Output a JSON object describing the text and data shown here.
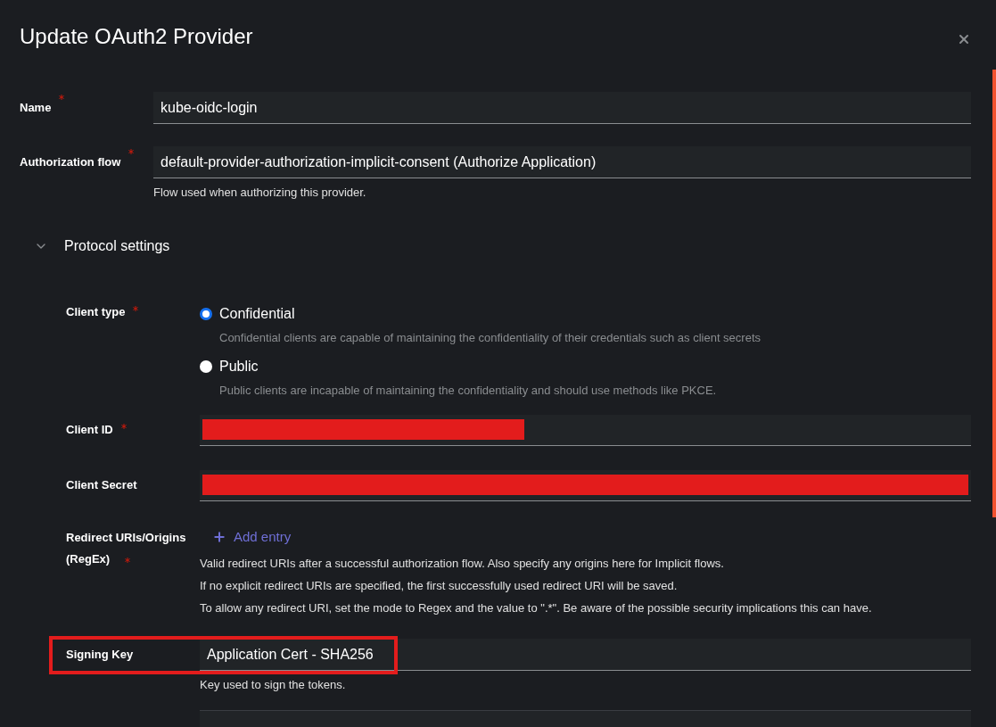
{
  "dialog": {
    "title": "Update OAuth2 Provider"
  },
  "fields": [
    {
      "label": "Name",
      "required": true,
      "value": "kube-oidc-login"
    },
    {
      "label": "Authorization flow",
      "required": true,
      "value": "default-provider-authorization-implicit-consent (Authorize Application)",
      "help": "Flow used when authorizing this provider."
    }
  ],
  "protocol_settings": {
    "label": "Protocol settings",
    "expanded": true,
    "client_type": {
      "label": "Client type",
      "required": true,
      "options": [
        {
          "label": "Confidential",
          "description": "Confidential clients are capable of maintaining the confidentiality of their credentials such as client secrets",
          "selected": true
        },
        {
          "label": "Public",
          "description": "Public clients are incapable of maintaining the confidentiality and should use methods like PKCE.",
          "selected": false
        }
      ]
    },
    "secrets": [
      {
        "label": "Client ID",
        "required": true,
        "kind": "partial"
      },
      {
        "label": "Client Secret",
        "kind": "full"
      }
    ],
    "redirect": {
      "label": "Redirect URIs/Origins (RegEx)",
      "required": true,
      "add_button": "Add entry",
      "help": [
        "Valid redirect URIs after a successful authorization flow. Also specify any origins here for Implicit flows.",
        "If no explicit redirect URIs are specified, the first successfully used redirect URI will be saved.",
        "To allow any redirect URI, set the mode to Regex and the value to \".*\". Be aware of the possible security implications this can have."
      ]
    },
    "signing_key": {
      "label": "Signing Key",
      "value": "Application Cert - SHA256",
      "help": "Key used to sign the tokens.",
      "highlighted": true
    }
  }
}
